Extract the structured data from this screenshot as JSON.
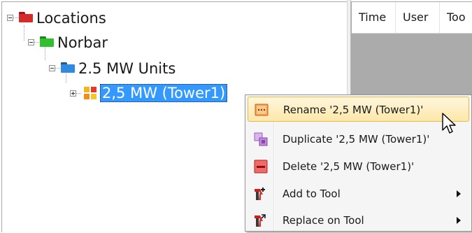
{
  "tree": {
    "nodes": [
      {
        "label": "Locations",
        "expanded": true,
        "color": "#cc2222"
      },
      {
        "label": "Norbar",
        "expanded": true,
        "color": "#22a822"
      },
      {
        "label": "2.5 MW Units",
        "expanded": true,
        "color": "#1c74c4"
      },
      {
        "label": "2,5 MW (Tower1)",
        "expanded": false,
        "selected": true
      }
    ]
  },
  "table": {
    "columns": [
      "Time",
      "User",
      "Too"
    ]
  },
  "context_menu": {
    "items": [
      {
        "label": "Rename '2,5 MW (Tower1)'",
        "icon": "rename-icon",
        "highlighted": true
      },
      {
        "label": "Duplicate '2,5 MW (Tower1)'",
        "icon": "duplicate-icon"
      },
      {
        "label": "Delete '2,5 MW (Tower1)'",
        "icon": "delete-icon"
      },
      {
        "label": "Add to Tool",
        "icon": "add-to-tool-icon",
        "submenu": true
      },
      {
        "label": "Replace on Tool",
        "icon": "replace-on-tool-icon",
        "submenu": true
      }
    ]
  }
}
